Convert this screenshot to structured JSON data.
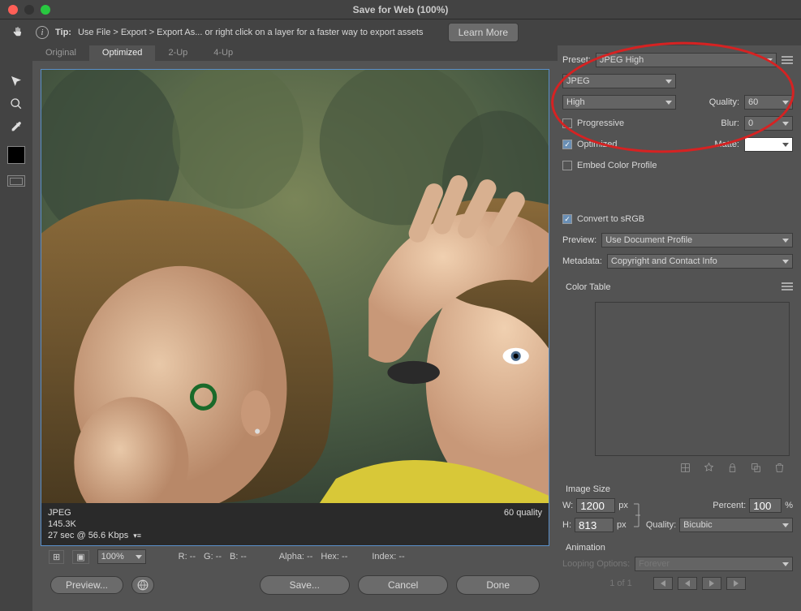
{
  "window": {
    "title": "Save for Web (100%)"
  },
  "tip": {
    "label": "Tip:",
    "text": "Use File > Export > Export As...  or right click on a layer for a faster way to export assets",
    "learn_more": "Learn More"
  },
  "tabs": [
    "Original",
    "Optimized",
    "2-Up",
    "4-Up"
  ],
  "active_tab": 1,
  "preview": {
    "format": "JPEG",
    "quality_text": "60 quality",
    "size": "145.3K",
    "time": "27 sec @ 56.6 Kbps"
  },
  "status": {
    "zoom": "100%",
    "R": "R: --",
    "G": "G: --",
    "B": "B: --",
    "Alpha": "Alpha: --",
    "Hex": "Hex: --",
    "Index": "Index: --"
  },
  "buttons": {
    "preview": "Preview...",
    "save": "Save...",
    "cancel": "Cancel",
    "done": "Done"
  },
  "settings": {
    "preset_label": "Preset:",
    "preset_value": "JPEG High",
    "format": "JPEG",
    "quality_preset": "High",
    "quality_label": "Quality:",
    "quality_value": "60",
    "progressive_label": "Progressive",
    "progressive": false,
    "blur_label": "Blur:",
    "blur_value": "0",
    "optimized_label": "Optimized",
    "optimized": true,
    "matte_label": "Matte:",
    "embed_label": "Embed Color Profile",
    "embed": false,
    "srgb_label": "Convert to sRGB",
    "srgb": true,
    "preview_label": "Preview:",
    "preview_value": "Use Document Profile",
    "metadata_label": "Metadata:",
    "metadata_value": "Copyright and Contact Info",
    "colortable_label": "Color Table"
  },
  "image_size": {
    "header": "Image Size",
    "w_label": "W:",
    "w": "1200",
    "h_label": "H:",
    "h": "813",
    "px": "px",
    "percent_label": "Percent:",
    "percent": "100",
    "percent_sym": "%",
    "quality_label": "Quality:",
    "quality": "Bicubic"
  },
  "animation": {
    "header": "Animation",
    "loop_label": "Looping Options:",
    "loop_value": "Forever",
    "page": "1 of 1"
  }
}
